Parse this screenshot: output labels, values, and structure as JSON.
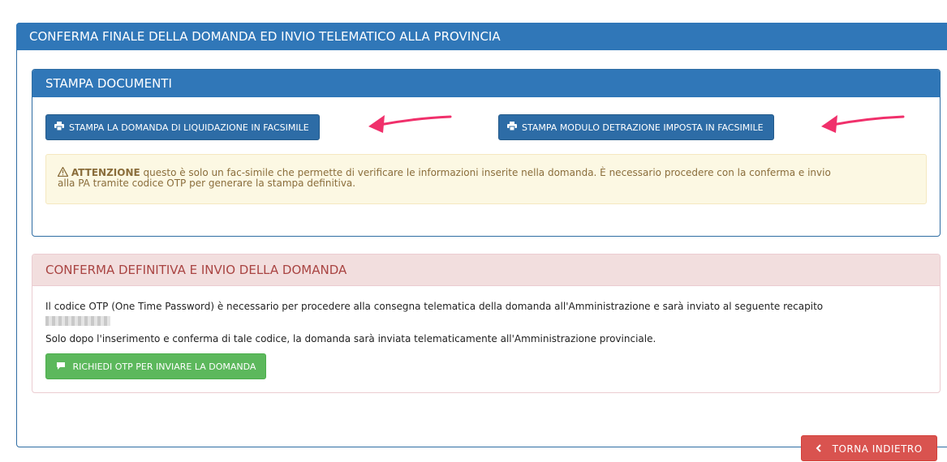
{
  "main_panel": {
    "title": "CONFERMA FINALE DELLA DOMANDA ED INVIO TELEMATICO ALLA PROVINCIA"
  },
  "stampa_panel": {
    "title": "STAMPA DOCUMENTI",
    "btn_domanda": "STAMPA LA DOMANDA DI LIQUIDAZIONE IN FACSIMILE",
    "btn_modulo": "STAMPA MODULO DETRAZIONE IMPOSTA IN FACSIMILE",
    "warning_label": "ATTENZIONE",
    "warning_line1": " questo è solo un fac-simile che permette di verificare le informazioni inserite nella domanda. È necessario procedere con la conferma e invio",
    "warning_line2": "alla PA tramite codice OTP per generare la stampa definitiva."
  },
  "conferma_panel": {
    "title": "CONFERMA DEFINITIVA E INVIO DELLA DOMANDA",
    "text1": "Il codice OTP (One Time Password) è necessario per procedere alla consegna telematica della domanda all'Amministrazione e sarà inviato al seguente recapito",
    "text2": "Solo dopo l'inserimento e conferma di tale codice, la domanda sarà inviata telematicamente all'Amministrazione provinciale.",
    "btn_otp": "RICHIEDI OTP PER INVIARE LA DOMANDA"
  },
  "back_button": "TORNA INDIETRO",
  "colors": {
    "primary": "#3077b8",
    "warning_bg": "#fcf8e3",
    "danger_header": "#f2dede",
    "success": "#5cb85c",
    "danger": "#d9534f",
    "arrow": "#f0306b"
  }
}
